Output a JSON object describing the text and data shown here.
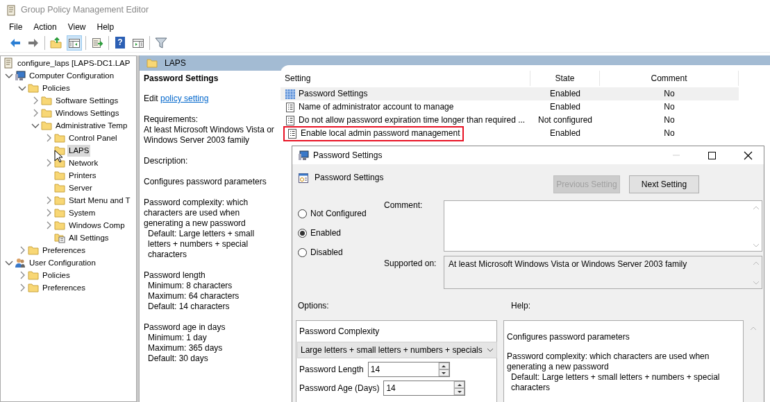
{
  "window": {
    "title": "Group Policy Management Editor"
  },
  "menu": [
    {
      "label": "File"
    },
    {
      "label": "Action"
    },
    {
      "label": "View"
    },
    {
      "label": "Help"
    }
  ],
  "toolbar": [
    [
      {
        "kind": "back",
        "selected": false
      },
      {
        "kind": "forward",
        "selected": false
      }
    ],
    [
      {
        "kind": "up",
        "selected": false
      },
      {
        "kind": "tree",
        "selected": true
      }
    ],
    [
      {
        "kind": "export",
        "selected": false
      }
    ],
    [
      {
        "kind": "help",
        "label": "?",
        "selected": false
      },
      {
        "kind": "actionpane",
        "selected": false
      }
    ],
    [
      {
        "kind": "filter",
        "selected": false
      }
    ]
  ],
  "tree": {
    "label": "configure_laps [LAPS-DC1.LAP",
    "kind": "document",
    "selected": false,
    "children": [
      {
        "label": "Computer Configuration",
        "kind": "computer",
        "expanded": true,
        "selected": false,
        "children": [
          {
            "label": "Policies",
            "kind": "folder",
            "expanded": true,
            "selected": false,
            "children": [
              {
                "label": "Software Settings",
                "kind": "folder",
                "expanded": false,
                "selected": false
              },
              {
                "label": "Windows Settings",
                "kind": "folder",
                "expanded": false,
                "selected": false
              },
              {
                "label": "Administrative Temp",
                "kind": "folder",
                "expanded": true,
                "selected": false,
                "children": [
                  {
                    "label": "Control Panel",
                    "kind": "folder",
                    "expanded": false,
                    "selected": false
                  },
                  {
                    "label": "LAPS",
                    "kind": "folder",
                    "selected": true
                  },
                  {
                    "label": "Network",
                    "kind": "folder",
                    "expanded": false,
                    "selected": false
                  },
                  {
                    "label": "Printers",
                    "kind": "folder",
                    "selected": false
                  },
                  {
                    "label": "Server",
                    "kind": "folder",
                    "selected": false
                  },
                  {
                    "label": "Start Menu and T",
                    "kind": "folder",
                    "expanded": false,
                    "selected": false
                  },
                  {
                    "label": "System",
                    "kind": "folder",
                    "expanded": false,
                    "selected": false
                  },
                  {
                    "label": "Windows Comp",
                    "kind": "folder",
                    "expanded": false,
                    "selected": false
                  },
                  {
                    "label": "All Settings",
                    "kind": "allsettings",
                    "selected": false
                  }
                ]
              }
            ]
          },
          {
            "label": "Preferences",
            "kind": "folder",
            "expanded": false,
            "selected": false
          }
        ]
      },
      {
        "label": "User Configuration",
        "kind": "user",
        "expanded": true,
        "selected": false,
        "children": [
          {
            "label": "Policies",
            "kind": "folder",
            "expanded": false,
            "selected": false
          },
          {
            "label": "Preferences",
            "kind": "folder",
            "expanded": false,
            "selected": false
          }
        ]
      }
    ]
  },
  "details": {
    "header": "LAPS",
    "title": "Password Settings",
    "edit_prefix": "Edit",
    "edit_link": "policy setting",
    "paragraphs": [
      [
        {
          "kind": "text",
          "text": "Requirements:"
        },
        {
          "kind": "text",
          "text": "At least Microsoft Windows Vista or Windows Server 2003 family"
        }
      ],
      [
        {
          "kind": "text",
          "text": "Description:"
        }
      ],
      [
        {
          "kind": "text",
          "text": "Configures password parameters"
        }
      ],
      [
        {
          "kind": "text",
          "text": "Password complexity: which characters are used when generating a new password"
        },
        {
          "kind": "detail",
          "text": "Default: Large letters + small letters + numbers + special characters"
        }
      ],
      [
        {
          "kind": "text",
          "text": "Password length"
        },
        {
          "kind": "detail",
          "text": "Minimum: 8 characters"
        },
        {
          "kind": "detail",
          "text": "Maximum: 64 characters"
        },
        {
          "kind": "detail",
          "text": "Default: 14 characters"
        }
      ],
      [
        {
          "kind": "text",
          "text": "Password age in days"
        },
        {
          "kind": "detail",
          "text": "Minimum: 1 day"
        },
        {
          "kind": "detail",
          "text": "Maximum: 365 days"
        },
        {
          "kind": "detail",
          "text": "Default: 30 days"
        }
      ]
    ]
  },
  "list": {
    "columns": [
      "Setting",
      "State",
      "Comment"
    ],
    "rows": [
      {
        "kind": "group",
        "setting": "Password Settings",
        "state": "Enabled",
        "comment": "No",
        "selected": true,
        "outlined": false
      },
      {
        "kind": "policy",
        "setting": "Name of administrator account to manage",
        "state": "Enabled",
        "comment": "No",
        "selected": false,
        "outlined": false
      },
      {
        "kind": "policy",
        "setting": "Do not allow password expiration time longer than required ...",
        "state": "Not configured",
        "comment": "No",
        "selected": false,
        "outlined": false
      },
      {
        "kind": "policy",
        "setting": "Enable local admin password management",
        "state": "Enabled",
        "comment": "No",
        "selected": false,
        "outlined": true
      }
    ]
  },
  "dialog": {
    "title": "Password Settings",
    "window_buttons": [
      {
        "kind": "minimize",
        "disabled": true
      },
      {
        "kind": "maximize",
        "disabled": false
      },
      {
        "kind": "close",
        "disabled": false
      }
    ],
    "policy_name": "Password Settings",
    "buttons": [
      {
        "label": "Previous Setting",
        "disabled": true
      },
      {
        "label": "Next Setting",
        "disabled": false
      }
    ],
    "radios": [
      {
        "label": "Not Configured",
        "selected": false
      },
      {
        "label": "Enabled",
        "selected": true
      },
      {
        "label": "Disabled",
        "selected": false
      }
    ],
    "comment_label": "Comment:",
    "supported_label": "Supported on:",
    "supported_text": "At least Microsoft Windows Vista or Windows Server 2003 family",
    "options_label": "Options:",
    "help_label": "Help:",
    "options": [
      {
        "kind": "label",
        "label": "Password Complexity"
      },
      {
        "kind": "select",
        "value": "Large letters + small letters + numbers + specials"
      },
      {
        "kind": "spin",
        "label": "Password Length",
        "value": "14"
      },
      {
        "kind": "spin",
        "label": "Password Age (Days)",
        "value": "14"
      }
    ],
    "help": [
      [
        {
          "kind": "text",
          "text": "Configures password parameters"
        }
      ],
      [
        {
          "kind": "text",
          "text": "Password complexity: which characters are used when generating a new password"
        },
        {
          "kind": "detail",
          "text": "Default: Large letters + small letters + numbers + special characters"
        }
      ]
    ]
  }
}
